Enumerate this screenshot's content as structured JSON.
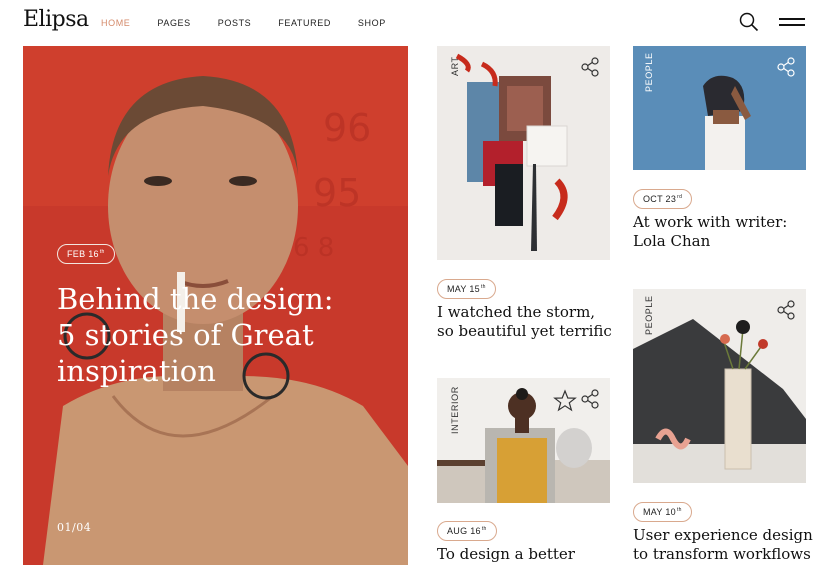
{
  "header": {
    "logo": "Elipsa",
    "nav": [
      "HOME",
      "PAGES",
      "POSTS",
      "FEATURED",
      "SHOP"
    ],
    "active_nav": "HOME",
    "icons": [
      "search-icon",
      "hamburger-menu-icon"
    ]
  },
  "hero": {
    "date": "FEB 16",
    "date_suffix": "th",
    "title": "Behind the design: 5 stories of Great inspiration",
    "counter": "01/04"
  },
  "cards": [
    {
      "category": "ART",
      "date": "MAY 15",
      "date_suffix": "th",
      "title": "I watched the storm, so beautiful yet terrific"
    },
    {
      "category": "INTERIOR",
      "date": "AUG 16",
      "date_suffix": "th",
      "title": "To design a better"
    },
    {
      "category": "PEOPLE",
      "date": "OCT 23",
      "date_suffix": "rd",
      "title": "At work with writer: Lola Chan"
    },
    {
      "category": "PEOPLE",
      "date": "MAY 10",
      "date_suffix": "th",
      "title": "User experience design to transform workflows"
    }
  ],
  "colors": {
    "accent": "#d48a6a",
    "hero_red": "#c8392b",
    "sky_blue": "#5a8db8",
    "badge_border": "#d9a98e"
  }
}
